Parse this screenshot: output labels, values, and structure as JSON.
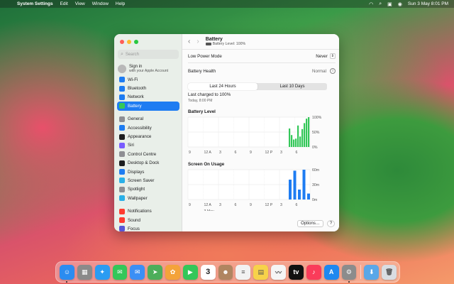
{
  "menubar": {
    "app": "System Settings",
    "menus": [
      "Edit",
      "View",
      "Window",
      "Help"
    ],
    "clock": "Sun 3 May  8:01 PM"
  },
  "window": {
    "search_placeholder": "Search",
    "apple_id": {
      "line1": "Sign in",
      "line2": "with your Apple Account"
    },
    "sidebar": [
      {
        "label": "Wi-Fi",
        "icon": "wifi-icon",
        "color": "#1e7cf2"
      },
      {
        "label": "Bluetooth",
        "icon": "bluetooth-icon",
        "color": "#1e7cf2"
      },
      {
        "label": "Network",
        "icon": "globe-icon",
        "color": "#1e7cf2"
      },
      {
        "label": "Battery",
        "icon": "battery-icon",
        "color": "#34c759",
        "selected": true
      },
      {
        "label": "General",
        "icon": "gear-icon",
        "color": "#8e8e93"
      },
      {
        "label": "Accessibility",
        "icon": "accessibility-icon",
        "color": "#1e7cf2"
      },
      {
        "label": "Appearance",
        "icon": "appearance-icon",
        "color": "#1d1d1f"
      },
      {
        "label": "Siri",
        "icon": "siri-icon",
        "color": "#7a5cff"
      },
      {
        "label": "Control Centre",
        "icon": "control-centre-icon",
        "color": "#8e8e93"
      },
      {
        "label": "Desktop & Dock",
        "icon": "desktop-icon",
        "color": "#1d1d1f"
      },
      {
        "label": "Displays",
        "icon": "display-icon",
        "color": "#1e7cf2"
      },
      {
        "label": "Screen Saver",
        "icon": "screen-saver-icon",
        "color": "#2ab0e8"
      },
      {
        "label": "Spotlight",
        "icon": "spotlight-icon",
        "color": "#8e8e93"
      },
      {
        "label": "Wallpaper",
        "icon": "wallpaper-icon",
        "color": "#2ab0e8"
      },
      {
        "label": "Notifications",
        "icon": "bell-icon",
        "color": "#ff3b30"
      },
      {
        "label": "Sound",
        "icon": "speaker-icon",
        "color": "#ff3b30"
      },
      {
        "label": "Focus",
        "icon": "moon-icon",
        "color": "#5856d6"
      }
    ],
    "title": "Battery",
    "subtitle": "Battery Level: 100%",
    "low_power_label": "Low Power Mode",
    "low_power_value": "Never",
    "health_label": "Battery Health",
    "health_value": "Normal",
    "tabs": [
      "Last 24 Hours",
      "Last 10 Days"
    ],
    "last_charged": "Last charged to 100%",
    "last_charged_time": "Today, 8:00 PM",
    "options_button": "Options…",
    "help_button": "?"
  },
  "chart_data": [
    {
      "type": "bar",
      "title": "Battery Level",
      "y_ticks": [
        "100%",
        "50%",
        "0%"
      ],
      "ylim": [
        0,
        100
      ],
      "x_ticks": [
        "9",
        "12 A",
        "3",
        "6",
        "9",
        "12 P",
        "3",
        "6"
      ],
      "values": [
        62,
        40,
        25,
        28,
        72,
        35,
        60,
        80,
        95,
        100
      ],
      "bar_color": "#34c759"
    },
    {
      "type": "bar",
      "title": "Screen On Usage",
      "y_ticks": [
        "60m",
        "30m",
        "0m"
      ],
      "ylim": [
        0,
        60
      ],
      "x_ticks": [
        "9",
        "12 A",
        "3",
        "6",
        "9",
        "12 P",
        "3",
        "6"
      ],
      "x_sublabel": "3 May",
      "values": [
        40,
        58,
        20,
        60,
        12
      ],
      "bar_color": "#1e7cf2"
    }
  ],
  "dock": [
    {
      "name": "Finder",
      "icon": "finder-icon",
      "color": "#2b8cf0",
      "glyph": "☺",
      "running": true
    },
    {
      "name": "Launchpad",
      "icon": "launchpad-icon",
      "color": "#8a8a8a",
      "glyph": "▦"
    },
    {
      "name": "Safari",
      "icon": "safari-icon",
      "color": "#2a9cf2",
      "glyph": "✦"
    },
    {
      "name": "Messages",
      "icon": "messages-icon",
      "color": "#34c759",
      "glyph": "✉"
    },
    {
      "name": "Mail",
      "icon": "mail-icon",
      "color": "#3b8ff5",
      "glyph": "✉"
    },
    {
      "name": "Maps",
      "icon": "maps-icon",
      "color": "#4cae5a",
      "glyph": "➤"
    },
    {
      "name": "Photos",
      "icon": "photos-icon",
      "color": "#f4a33a",
      "glyph": "✿"
    },
    {
      "name": "FaceTime",
      "icon": "facetime-icon",
      "color": "#34c759",
      "glyph": "▶"
    },
    {
      "name": "Calendar",
      "icon": "calendar-icon",
      "color": "#ffffff",
      "glyph": "3"
    },
    {
      "name": "Contacts",
      "icon": "contacts-icon",
      "color": "#b08560",
      "glyph": "☻"
    },
    {
      "name": "Reminders",
      "icon": "reminders-icon",
      "color": "#f2f2f2",
      "glyph": "≡"
    },
    {
      "name": "Notes",
      "icon": "notes-icon",
      "color": "#f7d24a",
      "glyph": "▤"
    },
    {
      "name": "Freeform",
      "icon": "freeform-icon",
      "color": "#f5f5f5",
      "glyph": "〰"
    },
    {
      "name": "Apple TV",
      "icon": "tv-icon",
      "color": "#111111",
      "glyph": "tv"
    },
    {
      "name": "Music",
      "icon": "music-icon",
      "color": "#fa3c5a",
      "glyph": "♪"
    },
    {
      "name": "App Store",
      "icon": "app-store-icon",
      "color": "#1e88f0",
      "glyph": "A"
    },
    {
      "name": "System Settings",
      "icon": "settings-icon",
      "color": "#8c8c8c",
      "glyph": "⚙",
      "running": true
    },
    {
      "name": "Downloads",
      "icon": "downloads-icon",
      "color": "#5aa7e8",
      "glyph": "⬇"
    },
    {
      "name": "Trash",
      "icon": "trash-icon",
      "color": "#d9dde2",
      "glyph": "🗑"
    }
  ]
}
